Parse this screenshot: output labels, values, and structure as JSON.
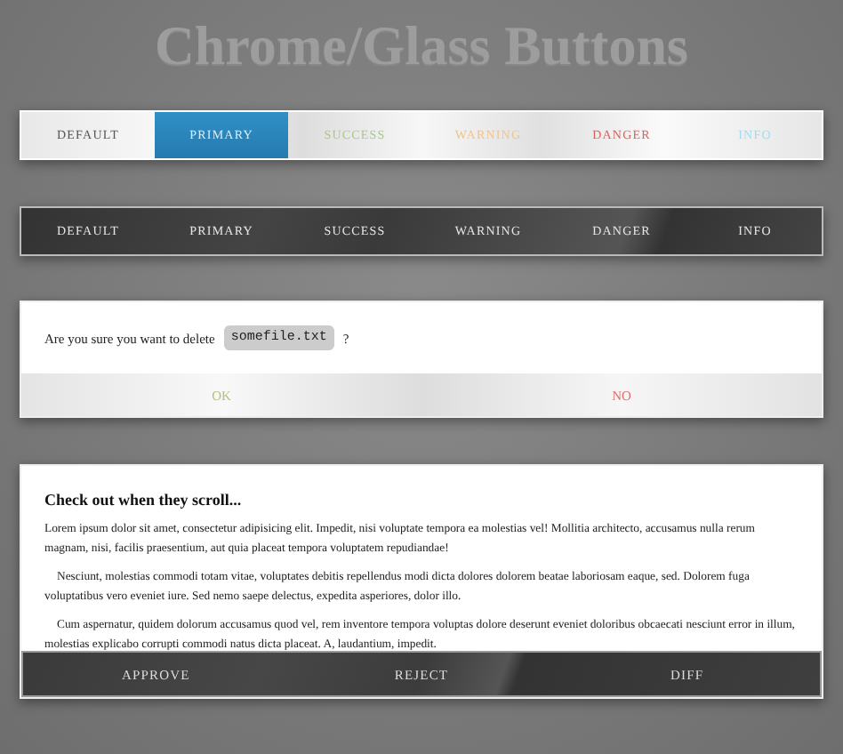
{
  "title": "Chrome/Glass Buttons",
  "light_bar": [
    {
      "label": "DEFAULT",
      "color": "#555555",
      "selected": false
    },
    {
      "label": "PRIMARY",
      "selected": true
    },
    {
      "label": "SUCCESS",
      "color": "#a9c98c",
      "selected": false
    },
    {
      "label": "WARNING",
      "color": "#f3c48a",
      "selected": false
    },
    {
      "label": "DANGER",
      "color": "#d9625c",
      "selected": false
    },
    {
      "label": "INFO",
      "color": "#9fdcf2",
      "selected": false
    }
  ],
  "dark_bar": [
    {
      "label": "DEFAULT"
    },
    {
      "label": "PRIMARY"
    },
    {
      "label": "SUCCESS"
    },
    {
      "label": "WARNING"
    },
    {
      "label": "DANGER"
    },
    {
      "label": "INFO"
    }
  ],
  "dialog": {
    "message": "Are you sure you want to delete",
    "filename": "somefile.txt",
    "suffix": "?",
    "buttons": [
      {
        "label": "OK",
        "color": "#b3c27a"
      },
      {
        "label": "NO",
        "color": "#e0706a"
      }
    ]
  },
  "card": {
    "heading": "Check out when they scroll...",
    "paragraphs": [
      {
        "text": "Lorem ipsum dolor sit amet, consectetur adipisicing elit. Impedit, nisi voluptate tempora ea molestias vel! Mollitia architecto, accusamus nulla rerum magnam, nisi, facilis praesentium, aut quia placeat tempora voluptatem repudiandae!",
        "indented": false
      },
      {
        "text": "Nesciunt, molestias commodi totam vitae, voluptates debitis repellendus modi dicta dolores dolorem beatae laboriosam eaque, sed. Dolorem fuga voluptatibus vero eveniet iure. Sed nemo saepe delectus, expedita asperiores, dolor illo.",
        "indented": true
      },
      {
        "text": "Cum aspernatur, quidem dolorum accusamus quod vel, rem inventore tempora voluptas dolore deserunt eveniet doloribus obcaecati nesciunt error in illum, molestias explicabo corrupti commodi natus dicta placeat. A, laudantium, impedit.",
        "indented": true
      }
    ],
    "buttons": [
      {
        "label": "APPROVE"
      },
      {
        "label": "REJECT"
      },
      {
        "label": "DIFF"
      }
    ]
  }
}
